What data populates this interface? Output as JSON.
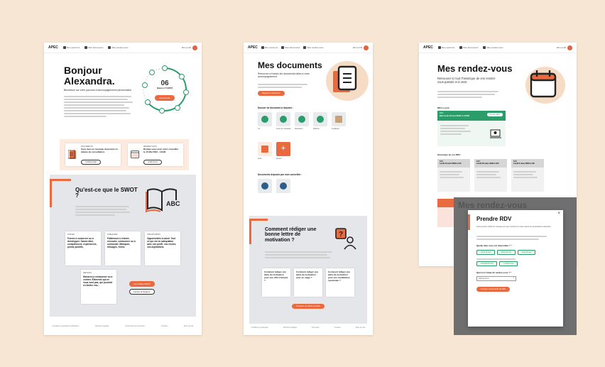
{
  "page1": {
    "nav": {
      "logo": "APEC",
      "items": [
        "Mon parcours",
        "Mes documents",
        "Mes rendez-vous",
        "Mes droits",
        "Aide/Contact"
      ],
      "user": "Mon profil"
    },
    "hero": {
      "title_line1": "Bonjour",
      "title_line2": "Alexandra.",
      "subtitle": "Bienvenue sur votre parcours d'accompagnement personnalisé",
      "step_number": "06",
      "step_label": "Séance n°6 SWOT",
      "step_button": "Commencer"
    },
    "doc_card": {
      "kicker": "DOCUMENTS",
      "text": "Vous avez un nouveau document en attente de consultation.",
      "button": "CONSULTER"
    },
    "rdv_card": {
      "kicker": "RENDEZ-VOUS",
      "text": "Rendez-vous avec votre conseiller le 10 Mai 2023 - 14h30.",
      "button": "VOIR PLUS"
    },
    "swot": {
      "title": "Qu'est-ce que le SWOT ?",
      "icon_text": "ABC",
      "cards": [
        {
          "kicker": "FORCES",
          "text": "Forces à conserver ou à développer. Savoir-faire, compétences, expériences, points positifs."
        },
        {
          "kicker": "FAIBLESSES",
          "text": "Faiblesses à réduire, résoudre, contourner ou à surmonter. Manques, blocages, freins."
        },
        {
          "kicker": "OPPORTUNITÉS",
          "text": "Opportunités à saisir. Tout ce qui est en adéquation avec ses profil, vos envies, vos aspirations."
        },
        {
          "kicker": "MENACES",
          "text": "Menaces à contourner ou à contrer. Éléments qui ne vous sont pas, qui pourrait en limiter vos..."
        }
      ],
      "btn_primary": "Les Grilles SWOT",
      "btn_secondary": "Lancer la Séance"
    },
    "footer": [
      "Conditions générales d'utilisation",
      "Mentions légales",
      "Protection des données",
      "Cookies",
      "Plan du site"
    ]
  },
  "page2": {
    "nav": {
      "logo": "APEC",
      "items": [
        "Mon parcours",
        "Mes documents",
        "Mes rendez-vous",
        "Mes droits",
        "Aide/Contact"
      ],
      "user": "Mon profil"
    },
    "title": "Mes documents",
    "intro": "Retrouvez ici toutes les documents utiles à votre accompagnement",
    "intro_button": "Déposer un document",
    "section1": "Dossier de document à déposer :",
    "section2": "Documents déposés par mon conseiller :",
    "tile_labels": [
      "CV",
      "Lettre de motivation",
      "Attestation",
      "Diplôme",
      "Justificatif",
      "Autre",
      "Ajouter"
    ],
    "motivation": {
      "title": "Comment rédiger une bonne lettre de motivation ?",
      "cards": [
        "Comment rédiger une lettre de motivation pour une offre d'emploi ?",
        "Comment rédiger une lettre de motivation pour un stage ?",
        "Comment rédiger une lettre de motivation pour une candidature spontanée ?"
      ],
      "button": "Consulter nos fiches conseils"
    },
    "footer": [
      "Conditions générales",
      "Mentions légales",
      "Données",
      "Cookies",
      "Plan du site"
    ]
  },
  "page3": {
    "nav": {
      "logo": "APEC",
      "items": [
        "Mon parcours",
        "Mes documents",
        "Mes rendez-vous",
        "Mes droits",
        "Aide/Contact"
      ],
      "user": "Mon profil"
    },
    "title": "Mes rendez-vous",
    "subtitle": "Retrouvez ici tout l'historique de vos rendez-vous passés et à venir.",
    "upcoming_label": "RDV à venir",
    "upcoming_card": {
      "kicker": "RDV",
      "date": "Mercredi 10 mai 2023 à 14h30",
      "button": "Prendre RDV"
    },
    "history_label": "Historique de vos RDV",
    "history_cards": [
      {
        "kicker": "RDV",
        "date": "Lundi 10 avril 2023 à 14h"
      },
      {
        "kicker": "RDV",
        "date": "Lundi 20 mars 2023 à 10h"
      },
      {
        "kicker": "RDV",
        "date": "Lundi 6 mars 2023 à 14h"
      }
    ],
    "bg_title": "Mes rendez-vous"
  },
  "modal": {
    "title": "Prendre RDV",
    "intro": "Vous pouvez choisir le créneau qui vous convient le mieux parmi les propositions suivantes.",
    "question1": "Quelle date vous est disponible ? *",
    "question2": "Quel est l'objet du rendez-vous ? *",
    "options_row1": [
      "Lundi 15 mai",
      "Mardi 16 mai",
      "Jeudi 18 mai"
    ],
    "options_row2": [
      "Vendredi 19 mai",
      "Lundi 22 mai"
    ],
    "select_placeholder": "Sélectionnez",
    "submit": "Envoyer ma demande de RDV",
    "close": "×"
  },
  "colors": {
    "background": "#f7e6d3",
    "accent": "#e96a3f",
    "green": "#2a9d6a",
    "grey_section": "#e4e6ea",
    "dark_overlay": "#6f6f6f"
  }
}
